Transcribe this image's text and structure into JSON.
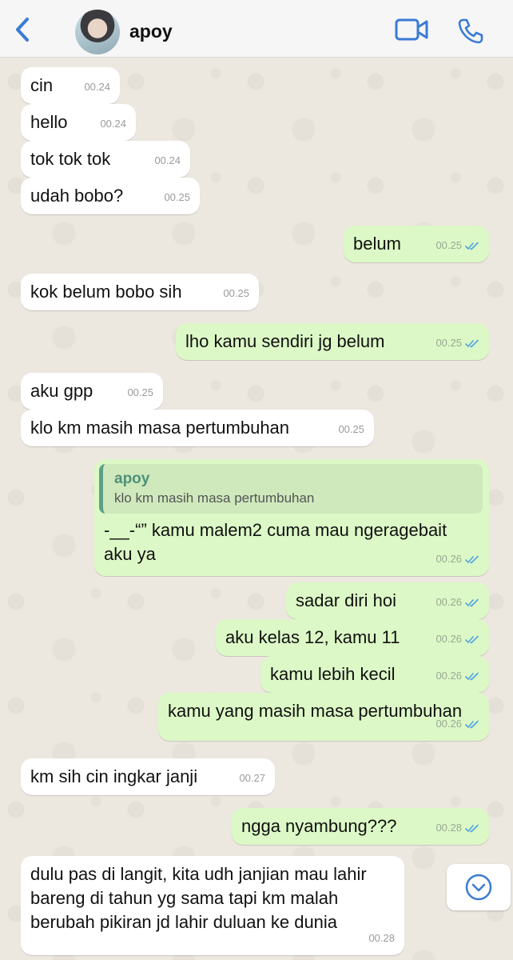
{
  "header": {
    "contact_name": "apoy",
    "back_icon": "chevron-left-icon",
    "video_icon": "video-camera-icon",
    "call_icon": "phone-icon",
    "accent_color": "#3a7bd5"
  },
  "messages": [
    {
      "dir": "in",
      "text": "cin",
      "time": "00.24"
    },
    {
      "dir": "in",
      "text": "hello",
      "time": "00.24"
    },
    {
      "dir": "in",
      "text": "tok tok tok",
      "time": "00.24"
    },
    {
      "dir": "in",
      "text": "udah bobo?",
      "time": "00.25"
    },
    {
      "dir": "out",
      "text": "belum",
      "time": "00.25"
    },
    {
      "dir": "in",
      "text": "kok belum bobo sih",
      "time": "00.25"
    },
    {
      "dir": "out",
      "text": "lho kamu sendiri jg belum",
      "time": "00.25"
    },
    {
      "dir": "in",
      "text": "aku gpp",
      "time": "00.25"
    },
    {
      "dir": "in",
      "text": "klo km masih masa pertumbuhan",
      "time": "00.25"
    },
    {
      "dir": "out",
      "text": "-__-“” kamu malem2 cuma mau ngeragebait aku ya",
      "time": "00.26",
      "quote": {
        "name": "apoy",
        "text": "klo km masih masa pertumbuhan"
      }
    },
    {
      "dir": "out",
      "text": "sadar diri hoi",
      "time": "00.26"
    },
    {
      "dir": "out",
      "text": "aku kelas 12, kamu 11",
      "time": "00.26"
    },
    {
      "dir": "out",
      "text": "kamu lebih kecil",
      "time": "00.26"
    },
    {
      "dir": "out",
      "text": "kamu yang masih masa pertumbuhan",
      "time": "00.26"
    },
    {
      "dir": "in",
      "text": "km sih cin ingkar janji",
      "time": "00.27"
    },
    {
      "dir": "out",
      "text": "ngga nyambung???",
      "time": "00.28"
    },
    {
      "dir": "in",
      "text": "dulu pas di langit, kita udh janjian mau lahir bareng di tahun yg sama tapi km malah berubah pikiran jd lahir duluan ke dunia",
      "time": "00.28"
    }
  ],
  "colors": {
    "incoming_bubble": "#ffffff",
    "outgoing_bubble": "#dcf8c6",
    "read_ticks": "#4fa3e3"
  },
  "scroll_down_icon": "chevron-down-circle-icon"
}
